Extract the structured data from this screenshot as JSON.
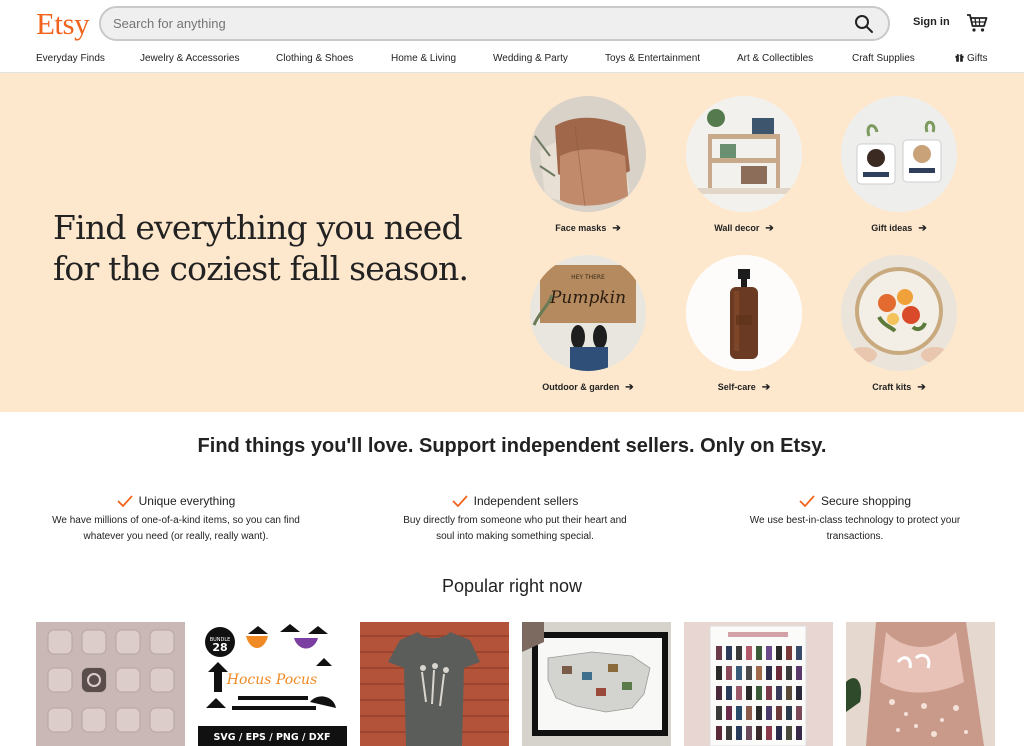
{
  "header": {
    "logo": "Etsy",
    "search_placeholder": "Search for anything",
    "signin": "Sign in"
  },
  "nav": [
    "Everyday Finds",
    "Jewelry & Accessories",
    "Clothing & Shoes",
    "Home & Living",
    "Wedding & Party",
    "Toys & Entertainment",
    "Art & Collectibles",
    "Craft Supplies",
    "Gifts"
  ],
  "hero": {
    "title": "Find everything you need for the coziest fall season.",
    "categories": [
      {
        "label": "Face masks"
      },
      {
        "label": "Wall decor"
      },
      {
        "label": "Gift ideas"
      },
      {
        "label": "Outdoor & garden"
      },
      {
        "label": "Self-care"
      },
      {
        "label": "Craft kits"
      }
    ],
    "pumpkin_mat_text": "Pumpkin",
    "pumpkin_mat_small": "HEY THERE"
  },
  "tagline": "Find things you'll love. Support independent sellers. Only on Etsy.",
  "features": [
    {
      "title": "Unique everything",
      "desc": "We have millions of one-of-a-kind items, so you can find whatever you need (or really, really want)."
    },
    {
      "title": "Independent sellers",
      "desc": "Buy directly from someone who put their heart and soul into making something special."
    },
    {
      "title": "Secure shopping",
      "desc": "We use best-in-class technology to protect your transactions."
    }
  ],
  "popular": {
    "title": "Popular right now",
    "svg_bundle_text": "SVG / EPS / PNG / DXF",
    "svg_bundle_count": "28",
    "svg_bundle_word": "BUNDLE",
    "hocus_text": "Hocus Pocus"
  },
  "colors": {
    "brand": "#f1641e",
    "hero_bg": "#fde8ce"
  }
}
